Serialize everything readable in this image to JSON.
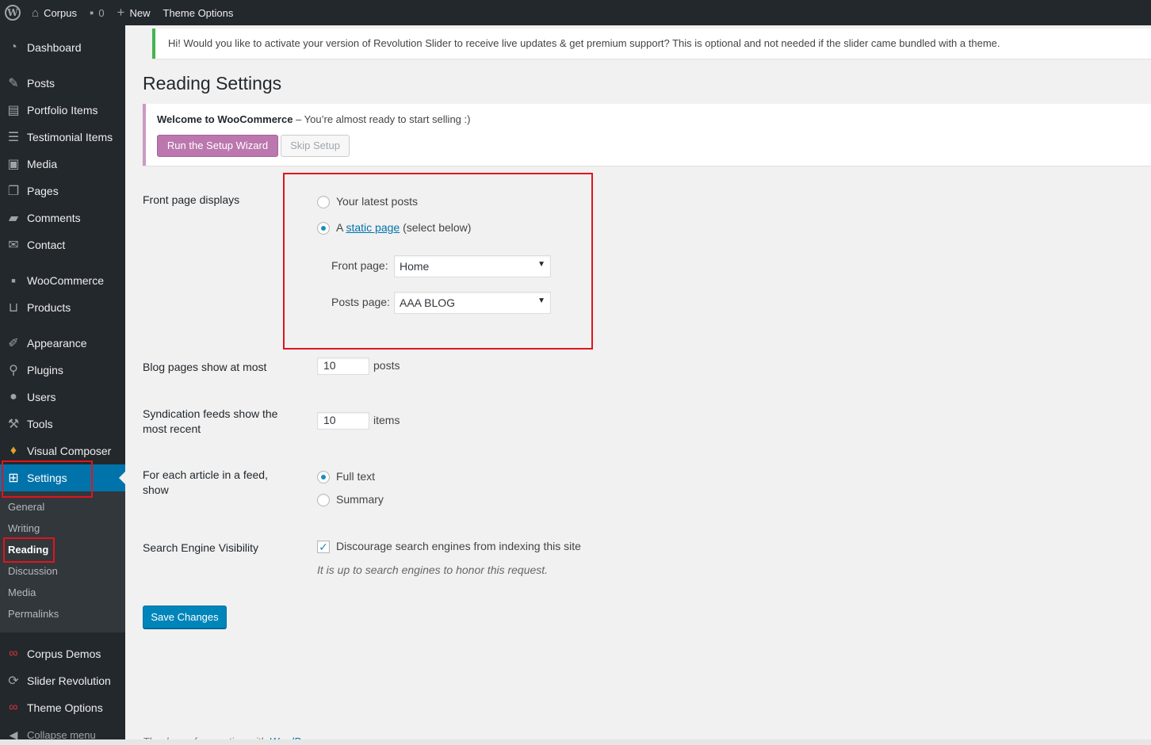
{
  "adminbar": {
    "site_name": "Corpus",
    "comments_count": "0",
    "new_label": "New",
    "theme_options_label": "Theme Options"
  },
  "sidebar": {
    "items": [
      {
        "label": "Dashboard",
        "icon": "dashboard-icon"
      },
      {
        "label": "Posts",
        "icon": "pin-icon"
      },
      {
        "label": "Portfolio Items",
        "icon": "portfolio-icon"
      },
      {
        "label": "Testimonial Items",
        "icon": "testimonial-icon"
      },
      {
        "label": "Media",
        "icon": "media-icon"
      },
      {
        "label": "Pages",
        "icon": "pages-icon"
      },
      {
        "label": "Comments",
        "icon": "comment-icon"
      },
      {
        "label": "Contact",
        "icon": "mail-icon"
      },
      {
        "label": "WooCommerce",
        "icon": "woo-icon"
      },
      {
        "label": "Products",
        "icon": "cart-icon"
      },
      {
        "label": "Appearance",
        "icon": "brush-icon"
      },
      {
        "label": "Plugins",
        "icon": "plugin-icon"
      },
      {
        "label": "Users",
        "icon": "user-icon"
      },
      {
        "label": "Tools",
        "icon": "wrench-icon"
      },
      {
        "label": "Visual Composer",
        "icon": "vc-icon"
      },
      {
        "label": "Settings",
        "icon": "settings-icon"
      },
      {
        "label": "Corpus Demos",
        "icon": "infinity-icon"
      },
      {
        "label": "Slider Revolution",
        "icon": "refresh-icon"
      },
      {
        "label": "Theme Options",
        "icon": "infinity-icon"
      },
      {
        "label": "Collapse menu",
        "icon": "collapse-icon"
      }
    ],
    "submenu": [
      "General",
      "Writing",
      "Reading",
      "Discussion",
      "Media",
      "Permalinks"
    ]
  },
  "notices": {
    "revslider": "Hi! Would you like to activate your version of Revolution Slider to receive live updates & get premium support? This is optional and not needed if the slider came bundled with a theme.",
    "woo_title": "Welcome to WooCommerce",
    "woo_text": " – You’re almost ready to start selling :)",
    "run_wizard": "Run the Setup Wizard",
    "skip_setup": "Skip Setup"
  },
  "page": {
    "title": "Reading Settings"
  },
  "form": {
    "front_page_displays_label": "Front page displays",
    "latest_posts_label": "Your latest posts",
    "static_prefix": "A ",
    "static_link": "static page",
    "static_suffix": " (select below)",
    "front_page_label": "Front page:",
    "front_page_value": "Home",
    "posts_page_label": "Posts page:",
    "posts_page_value": "AAA BLOG",
    "blog_pages_label": "Blog pages show at most",
    "blog_pages_value": "10",
    "blog_pages_unit": "posts",
    "syndication_label": "Syndication feeds show the most recent",
    "syndication_value": "10",
    "syndication_unit": "items",
    "feed_article_label": "For each article in a feed, show",
    "full_text_label": "Full text",
    "summary_label": "Summary",
    "seo_label": "Search Engine Visibility",
    "seo_checkbox_label": "Discourage search engines from indexing this site",
    "seo_desc": "It is up to search engines to honor this request.",
    "save_label": "Save Changes"
  },
  "footer": {
    "text": "Thank you for creating with ",
    "link": "WordPress"
  },
  "colors": {
    "sidebar_bg": "#23282d",
    "active_blue": "#0073aa",
    "highlight_red": "#e0141e",
    "woo_purple": "#bb77ae"
  }
}
